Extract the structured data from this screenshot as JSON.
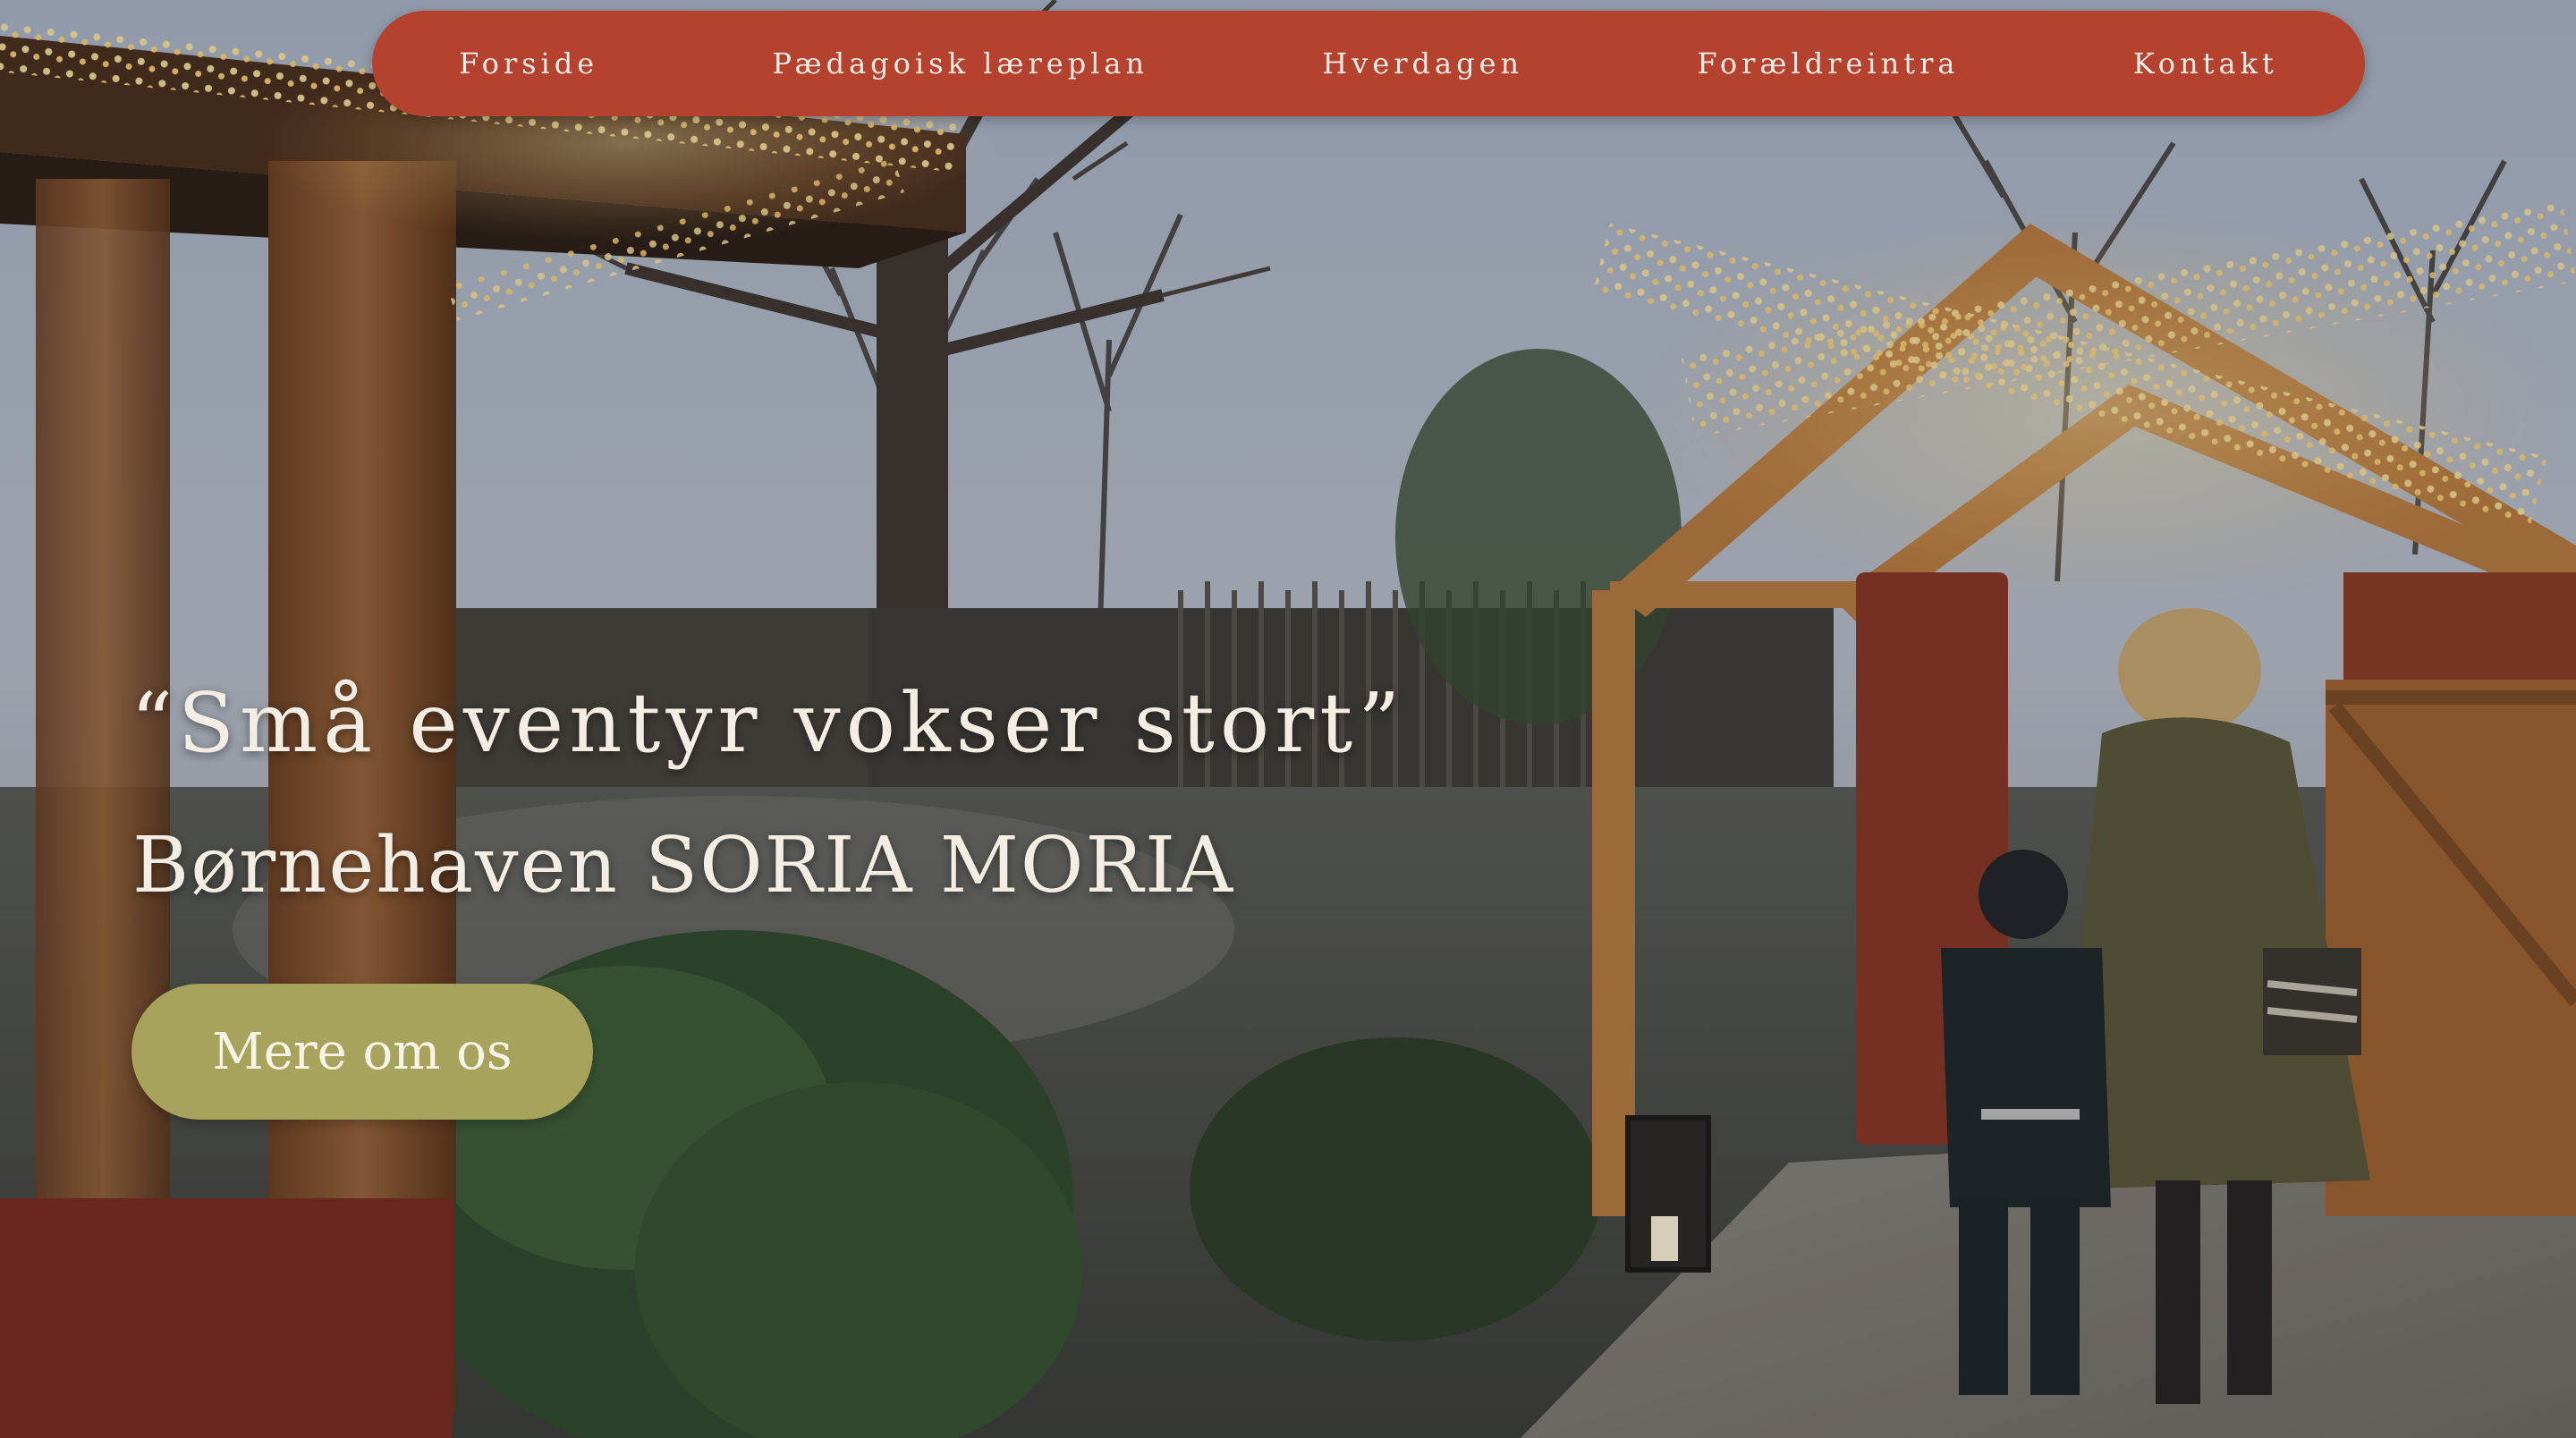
{
  "nav": {
    "items": [
      {
        "label": "Forside"
      },
      {
        "label": "Pædagoisk læreplan"
      },
      {
        "label": "Hverdagen"
      },
      {
        "label": "Forældreintra"
      },
      {
        "label": "Kontakt"
      }
    ]
  },
  "hero": {
    "quote": "“Små eventyr vokser stort”",
    "subtitle": "Børnehaven SORIA MORIA",
    "cta_label": "Mere om os"
  },
  "colors": {
    "nav_background": "#b5412f",
    "nav_text": "#f6ece6",
    "cta_background": "#a7a25c",
    "hero_text": "#f3ede4"
  }
}
